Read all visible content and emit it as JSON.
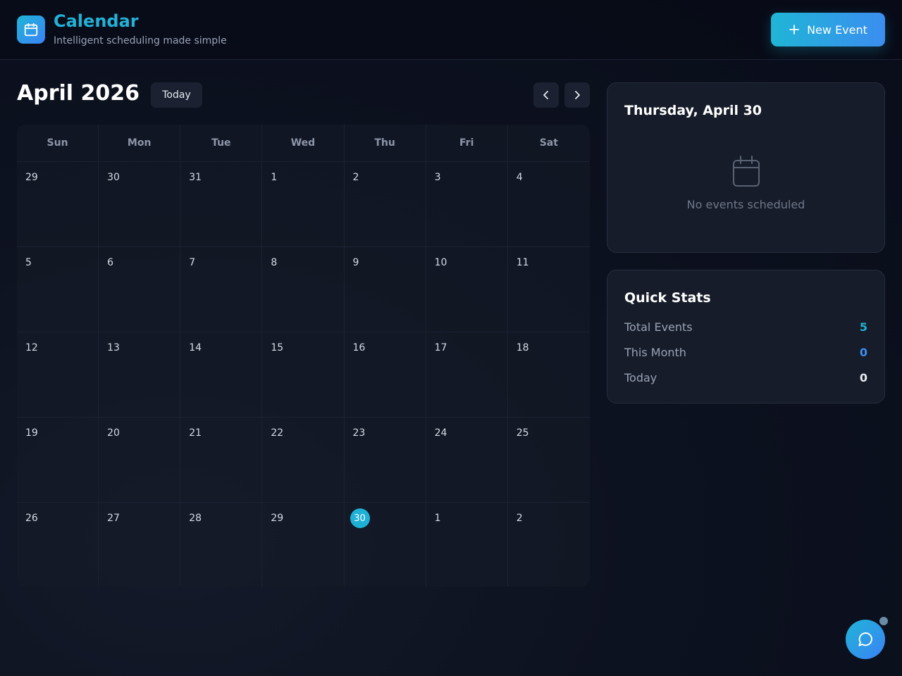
{
  "header": {
    "title": "Calendar",
    "subtitle": "Intelligent scheduling made simple",
    "new_event_label": "New Event",
    "logo_icon": "calendar-icon"
  },
  "calendar": {
    "month_label": "April 2026",
    "today_label": "Today",
    "weekdays": [
      "Sun",
      "Mon",
      "Tue",
      "Wed",
      "Thu",
      "Fri",
      "Sat"
    ],
    "weeks": [
      [
        "29",
        "30",
        "31",
        "1",
        "2",
        "3",
        "4"
      ],
      [
        "5",
        "6",
        "7",
        "8",
        "9",
        "10",
        "11"
      ],
      [
        "12",
        "13",
        "14",
        "15",
        "16",
        "17",
        "18"
      ],
      [
        "19",
        "20",
        "21",
        "22",
        "23",
        "24",
        "25"
      ],
      [
        "26",
        "27",
        "28",
        "29",
        "30",
        "1",
        "2"
      ]
    ],
    "today_cell": [
      4,
      4
    ]
  },
  "day_panel": {
    "title": "Thursday, April 30",
    "empty_text": "No events scheduled"
  },
  "stats": {
    "title": "Quick Stats",
    "total_label": "Total Events",
    "total_value": "5",
    "month_label": "This Month",
    "month_value": "0",
    "today_label": "Today",
    "today_value": "0"
  },
  "colors": {
    "accent": "#1fb5d6",
    "accent_blue": "#3b82f6",
    "background": "#0d1220"
  }
}
